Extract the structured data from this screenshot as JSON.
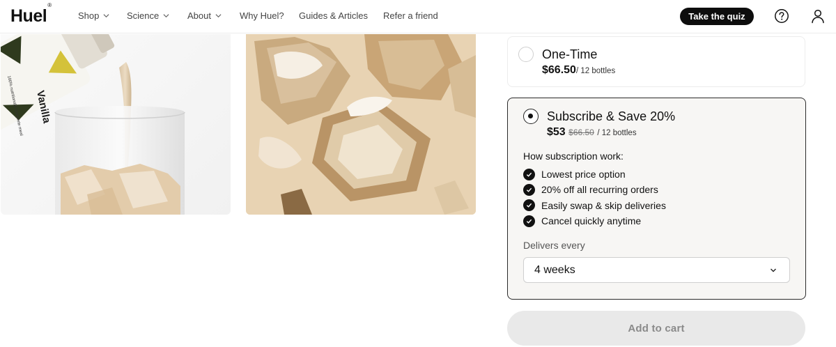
{
  "nav": {
    "logo": "Huel",
    "logo_mark": "®",
    "items": [
      {
        "label": "Shop",
        "dropdown": true
      },
      {
        "label": "Science",
        "dropdown": true
      },
      {
        "label": "About",
        "dropdown": true
      },
      {
        "label": "Why Huel?",
        "dropdown": false
      },
      {
        "label": "Guides & Articles",
        "dropdown": false
      },
      {
        "label": "Refer a friend",
        "dropdown": false
      }
    ],
    "quiz_button": "Take the quiz",
    "help_icon": "help-circle-icon",
    "account_icon": "user-icon"
  },
  "gallery": {
    "image1": {
      "bottle_text": "Vanilla",
      "bottle_subtext": "100% nutritionally complete meal"
    },
    "image2": {}
  },
  "purchase": {
    "one_time": {
      "title": "One-Time",
      "price": "$66.50",
      "unit": "/ 12 bottles",
      "selected": false
    },
    "subscribe": {
      "title": "Subscribe & Save 20%",
      "price": "$53",
      "original_price": "$66.50",
      "unit": "/ 12 bottles",
      "selected": true,
      "how_heading": "How subscription work:",
      "benefits": [
        "Lowest price option",
        "20% off all recurring orders",
        "Easily swap & skip deliveries",
        "Cancel quickly anytime"
      ],
      "delivers_label": "Delivers every",
      "delivers_value": "4 weeks"
    },
    "add_to_cart": "Add to cart"
  },
  "colors": {
    "primary": "#0d0d0d",
    "selected_card_bg": "#f7f6f4",
    "disabled_button": "#e9e9e9"
  }
}
